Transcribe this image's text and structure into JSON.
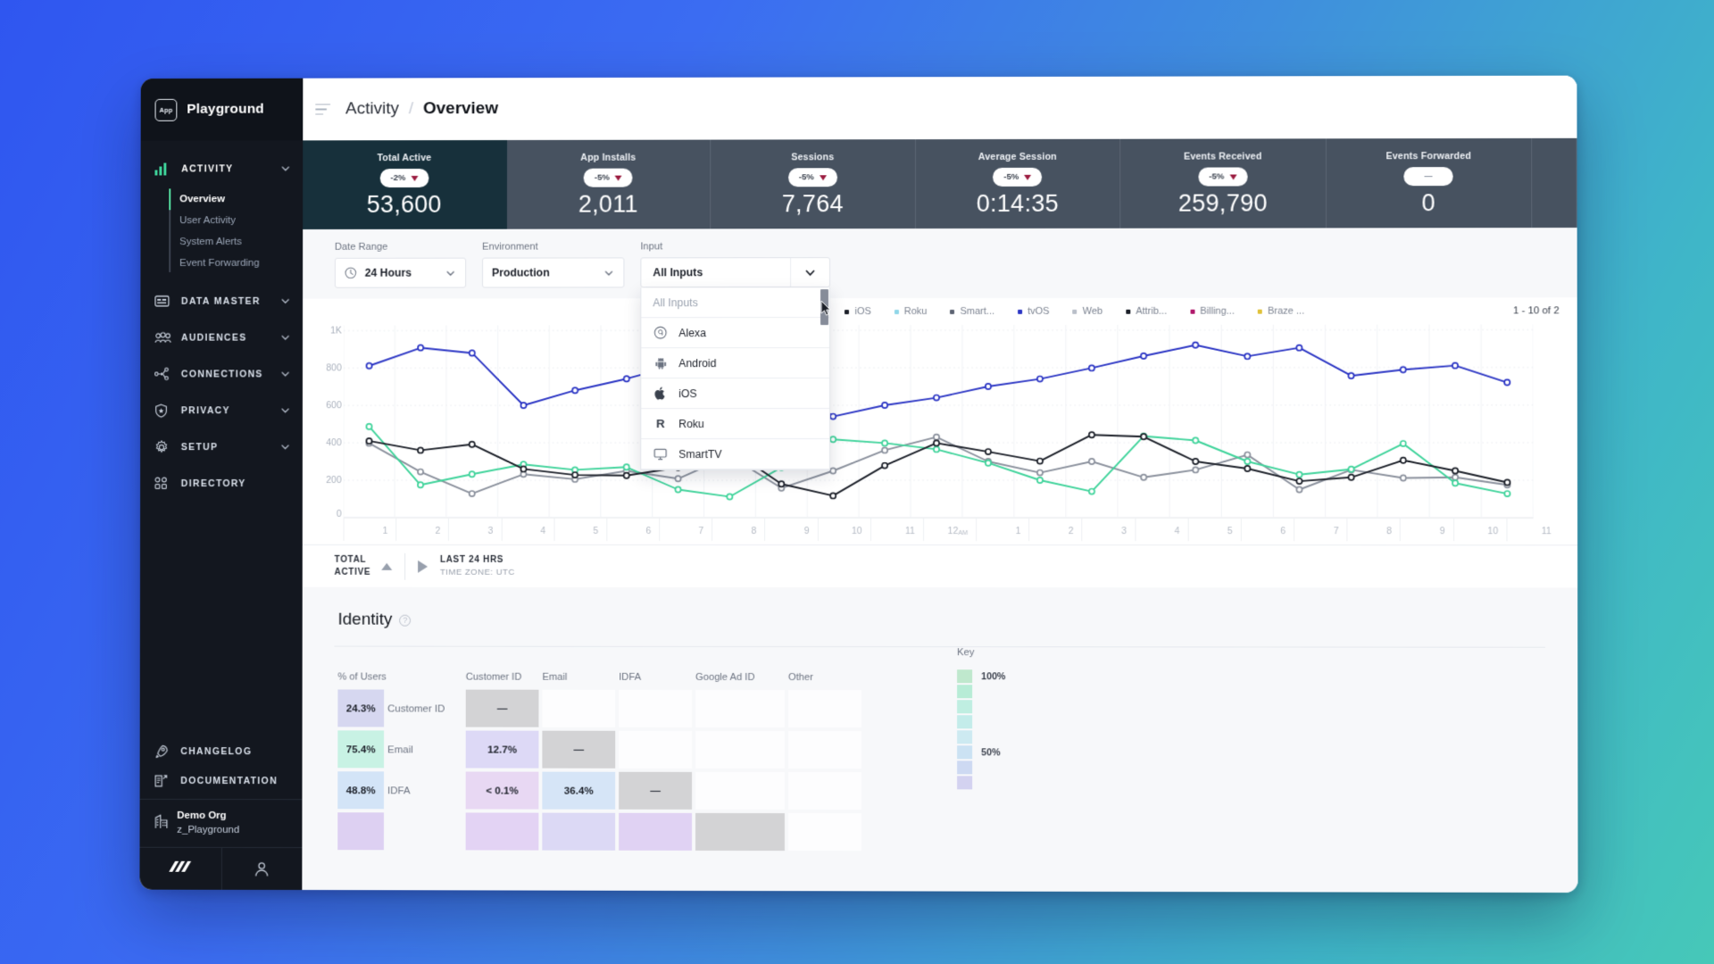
{
  "brand": {
    "logo_text": "App",
    "name": "Playground"
  },
  "sidebar": {
    "groups": [
      {
        "label": "ACTIVITY",
        "icon": "bar-chart-icon",
        "expanded": true,
        "items": [
          {
            "label": "Overview",
            "current": true
          },
          {
            "label": "User Activity",
            "current": false
          },
          {
            "label": "System Alerts",
            "current": false
          },
          {
            "label": "Event Forwarding",
            "current": false
          }
        ]
      },
      {
        "label": "DATA MASTER",
        "icon": "database-screen-icon",
        "expanded": false,
        "items": []
      },
      {
        "label": "AUDIENCES",
        "icon": "people-icon",
        "expanded": false,
        "items": []
      },
      {
        "label": "CONNECTIONS",
        "icon": "nodes-icon",
        "expanded": false,
        "items": []
      },
      {
        "label": "PRIVACY",
        "icon": "shield-star-icon",
        "expanded": false,
        "items": []
      },
      {
        "label": "SETUP",
        "icon": "gear-icon",
        "expanded": false,
        "items": []
      },
      {
        "label": "DIRECTORY",
        "icon": "grid-icon",
        "expanded": false,
        "items": []
      }
    ],
    "bottom_links": [
      {
        "label": "CHANGELOG",
        "icon": "rocket-icon"
      },
      {
        "label": "DOCUMENTATION",
        "icon": "document-external-icon"
      }
    ],
    "org": {
      "icon": "building-icon",
      "name": "Demo Org",
      "workspace": "z_Playground"
    },
    "footer_icons": [
      "app-logo-icon",
      "user-account-icon"
    ]
  },
  "header": {
    "menu_icon": "hamburger-icon",
    "breadcrumb_parent": "Activity",
    "breadcrumb_separator": "/",
    "breadcrumb_current": "Overview"
  },
  "kpis": [
    {
      "label": "Total Active",
      "delta": "-2%",
      "trend": "down",
      "value": "53,600",
      "selected": true
    },
    {
      "label": "App Installs",
      "delta": "-5%",
      "trend": "down",
      "value": "2,011",
      "selected": false
    },
    {
      "label": "Sessions",
      "delta": "-5%",
      "trend": "down",
      "value": "7,764",
      "selected": false
    },
    {
      "label": "Average Session",
      "delta": "-5%",
      "trend": "down",
      "value": "0:14:35",
      "selected": false
    },
    {
      "label": "Events Received",
      "delta": "-5%",
      "trend": "down",
      "value": "259,790",
      "selected": false
    },
    {
      "label": "Events Forwarded",
      "delta": "--",
      "trend": "none",
      "value": "0",
      "selected": false
    }
  ],
  "filters": {
    "date_range": {
      "label": "Date Range",
      "value": "24 Hours",
      "icon": "clock-icon"
    },
    "environment": {
      "label": "Environment",
      "value": "Production"
    },
    "input": {
      "label": "Input",
      "value": "All Inputs",
      "open": true
    }
  },
  "dropdown": {
    "header_option": "All Inputs",
    "options": [
      {
        "label": "Alexa",
        "icon": "alexa-icon"
      },
      {
        "label": "Android",
        "icon": "android-icon"
      },
      {
        "label": "iOS",
        "icon": "apple-icon"
      },
      {
        "label": "Roku",
        "icon": "roku-icon"
      },
      {
        "label": "SmartTV",
        "icon": "smarttv-icon"
      }
    ]
  },
  "chart_data": {
    "type": "line",
    "title": "Total Active",
    "xlabel": "",
    "ylabel": "",
    "ylim": [
      0,
      1000
    ],
    "ytick_labels": [
      "0",
      "200",
      "400",
      "600",
      "800",
      "1K"
    ],
    "yticks": [
      0,
      200,
      400,
      600,
      800,
      1000
    ],
    "grid": true,
    "legend_position": "top-right",
    "x": [
      "1",
      "2",
      "3",
      "4",
      "5",
      "6",
      "7",
      "8",
      "9",
      "10",
      "11",
      "12AM",
      "1",
      "2",
      "3",
      "4",
      "5",
      "6",
      "7",
      "8",
      "9",
      "10",
      "11"
    ],
    "series": [
      {
        "name": "Alexa",
        "color": "#8a909c",
        "values": [
          398,
          245,
          128,
          232,
          205,
          250,
          208,
          330,
          158,
          250,
          360,
          430,
          300,
          240,
          300,
          215,
          255,
          335,
          150,
          255,
          212,
          215,
          175
        ]
      },
      {
        "name": "Android",
        "color": "#3ed39a",
        "values": [
          487,
          175,
          232,
          285,
          255,
          270,
          150,
          112,
          268,
          418,
          398,
          365,
          292,
          200,
          140,
          435,
          412,
          300,
          230,
          258,
          395,
          185,
          128
        ]
      },
      {
        "name": "iOS",
        "color": "#1b1f28",
        "values": [
          410,
          360,
          392,
          260,
          228,
          225,
          268,
          368,
          180,
          117,
          278,
          398,
          352,
          302,
          442,
          432,
          300,
          262,
          195,
          215,
          306,
          250,
          188
        ]
      },
      {
        "name": "Roku",
        "color": "#2b35c4",
        "values": [
          812,
          908,
          880,
          600,
          680,
          742,
          816,
          648,
          786,
          540,
          600,
          640,
          700,
          740,
          798,
          862,
          920,
          860,
          905,
          756,
          788,
          810,
          720
        ]
      }
    ],
    "legend": [
      {
        "label": "Alexa",
        "color": "#8a909c"
      },
      {
        "label": "Android",
        "color": "#3ed39a"
      },
      {
        "label": "iOS",
        "color": "#1b1f28"
      },
      {
        "label": "Roku",
        "color": "#8fd6e8"
      },
      {
        "label": "Smart...",
        "color": "#5b6271"
      },
      {
        "label": "tvOS",
        "color": "#2b35c4"
      },
      {
        "label": "Web",
        "color": "#b9bfc9"
      },
      {
        "label": "Attrib...",
        "color": "#1b1f28"
      },
      {
        "label": "Billing...",
        "color": "#b0186b"
      },
      {
        "label": "Braze ...",
        "color": "#e0c23a"
      }
    ],
    "pagination": "1 - 10 of 2"
  },
  "chart_footer": {
    "metric_line1": "TOTAL",
    "metric_line2": "ACTIVE",
    "sort_icon": "sort-ascending-icon",
    "play_icon": "play-icon",
    "range": "LAST 24 HRS",
    "timezone": "TIME ZONE: UTC"
  },
  "identity": {
    "title": "Identity",
    "info_icon": "info-icon",
    "columns": [
      "% of Users",
      "Customer ID",
      "Email",
      "IDFA",
      "Google Ad ID",
      "Other"
    ],
    "rows": [
      {
        "pct": "24.3%",
        "pct_color": "#d6d7f0",
        "label": "Customer ID",
        "cells": [
          {
            "v": "—",
            "c": "#d3d3d5"
          },
          {
            "v": "",
            "c": ""
          },
          {
            "v": "",
            "c": ""
          },
          {
            "v": "",
            "c": ""
          },
          {
            "v": "",
            "c": ""
          }
        ]
      },
      {
        "pct": "75.4%",
        "pct_color": "#c8f2e4",
        "label": "Email",
        "cells": [
          {
            "v": "12.7%",
            "c": "#ddd9f6"
          },
          {
            "v": "—",
            "c": "#d3d3d5"
          },
          {
            "v": "",
            "c": ""
          },
          {
            "v": "",
            "c": ""
          },
          {
            "v": "",
            "c": ""
          }
        ]
      },
      {
        "pct": "48.8%",
        "pct_color": "#d3e4f7",
        "label": "IDFA",
        "cells": [
          {
            "v": "< 0.1%",
            "c": "#e8d8f3"
          },
          {
            "v": "36.4%",
            "c": "#d6e5f7"
          },
          {
            "v": "—",
            "c": "#d3d3d5"
          },
          {
            "v": "",
            "c": ""
          },
          {
            "v": "",
            "c": ""
          }
        ]
      },
      {
        "pct": "",
        "pct_color": "#ddd0f2",
        "label": "",
        "cells": [
          {
            "v": "",
            "c": "#e3d3f4"
          },
          {
            "v": "",
            "c": "#dcd9f5"
          },
          {
            "v": "",
            "c": "#e0d2f3"
          },
          {
            "v": "",
            "c": "#d3d3d5"
          },
          {
            "v": "",
            "c": ""
          }
        ]
      }
    ],
    "key": {
      "title": "Key",
      "top_label": "100%",
      "mid_label": "50%",
      "swatches": [
        "#bfe8cd",
        "#b7ecd6",
        "#bfeee1",
        "#c3ecea",
        "#cdeaf1",
        "#cbe2f3",
        "#cdd9f2",
        "#d3d2f0"
      ]
    }
  }
}
